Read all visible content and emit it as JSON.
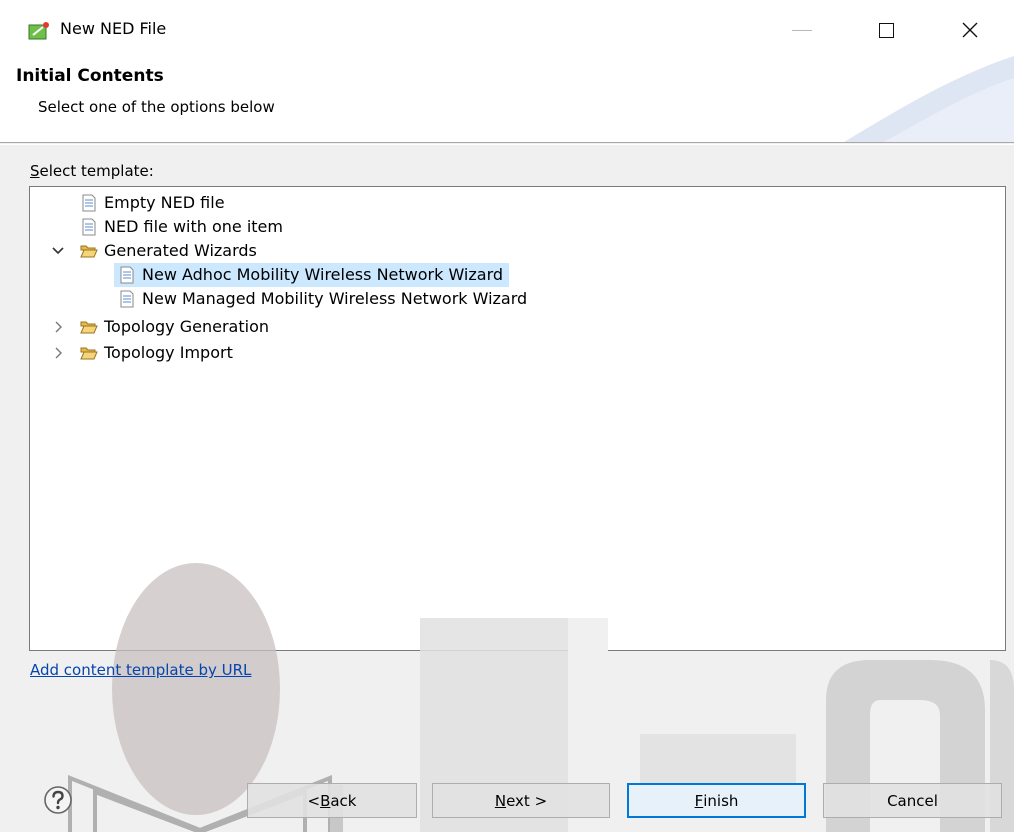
{
  "window": {
    "title": "New NED File",
    "icon": "ned-file-wizard-icon"
  },
  "banner": {
    "title": "Initial Contents",
    "description": "Select one of the options below"
  },
  "template_label": {
    "mnemonic": "S",
    "rest": "elect template:"
  },
  "tree": {
    "items": [
      {
        "label": "Empty NED file",
        "icon": "file-icon"
      },
      {
        "label": "NED file with one item",
        "icon": "file-icon"
      },
      {
        "label": "Generated Wizards",
        "icon": "folder-open-icon",
        "expanded": true
      },
      {
        "label": "New Adhoc Mobility Wireless Network Wizard",
        "icon": "file-icon",
        "selected": true
      },
      {
        "label": "New Managed Mobility Wireless Network Wizard",
        "icon": "file-icon"
      },
      {
        "label": "Topology Generation",
        "icon": "folder-open-icon",
        "expanded": false
      },
      {
        "label": "Topology Import",
        "icon": "folder-open-icon",
        "expanded": false
      }
    ]
  },
  "add_link": "Add content template by URL",
  "buttons": {
    "back": {
      "prefix": "< ",
      "mnemonic": "B",
      "rest": "ack"
    },
    "next": {
      "mnemonic": "N",
      "rest": "ext >"
    },
    "finish": {
      "mnemonic": "F",
      "rest": "inish"
    },
    "cancel": "Cancel"
  },
  "colors": {
    "selection": "#cce8ff",
    "link": "#0645ad",
    "default_button_border": "#0078d7"
  }
}
